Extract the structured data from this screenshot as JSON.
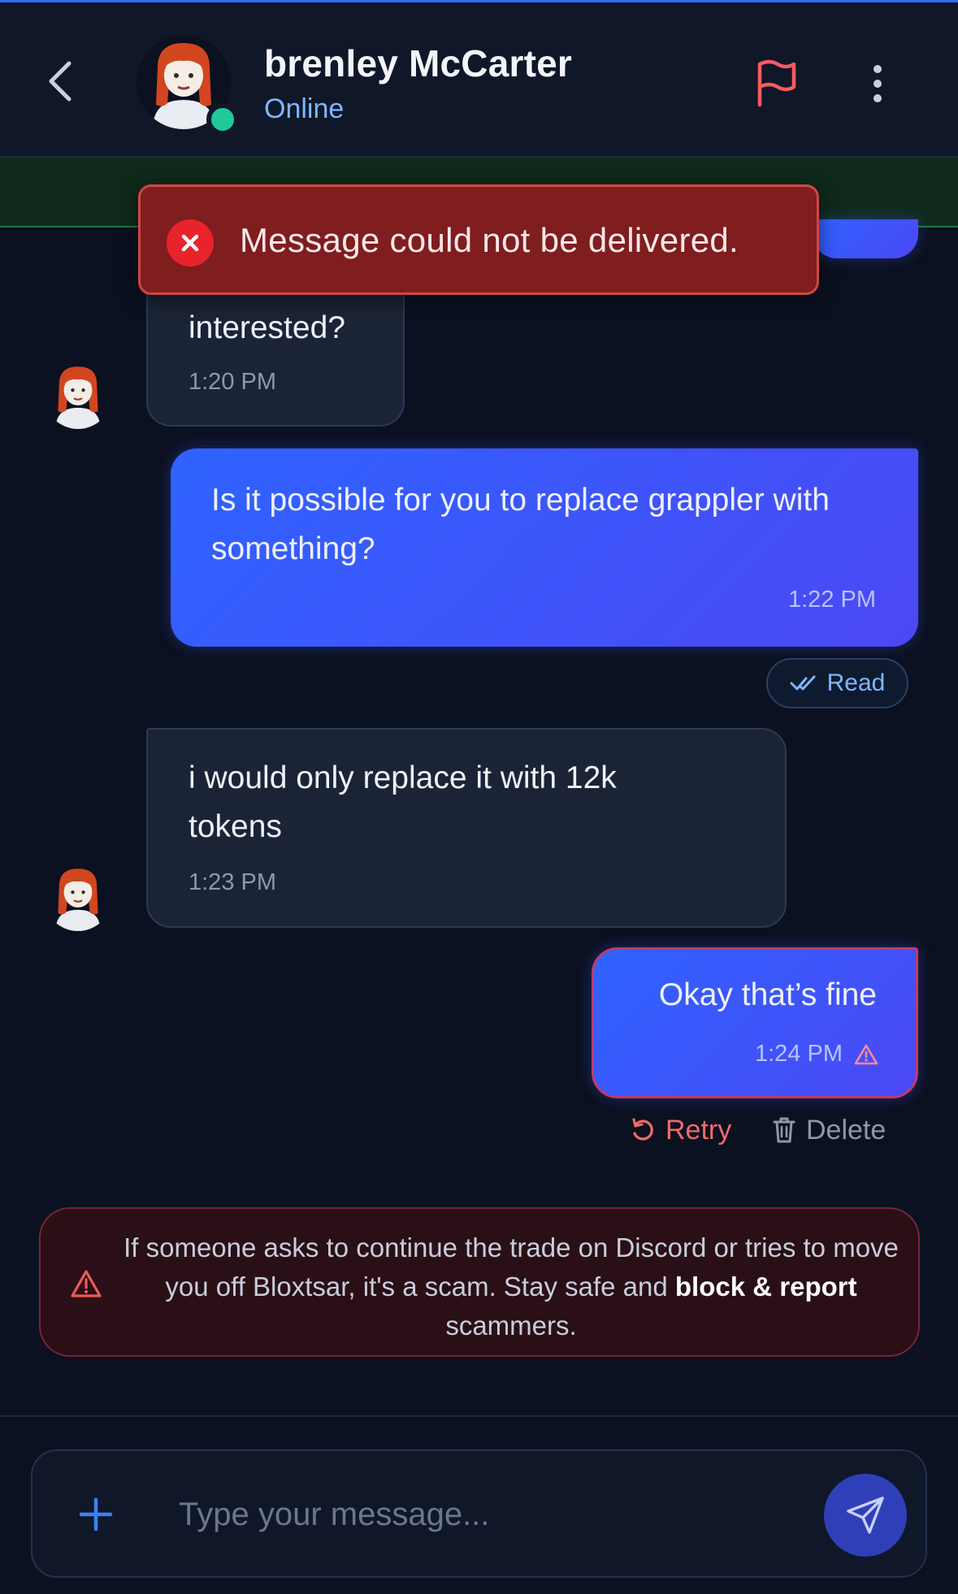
{
  "header": {
    "contact_name": "brenley McCarter",
    "status": "Online"
  },
  "toast": {
    "message": "Message could not be delivered."
  },
  "messages": [
    {
      "direction": "in",
      "text": "interested?",
      "time": "1:20 PM"
    },
    {
      "direction": "out",
      "text": "Is it possible for you to replace grappler with something?",
      "time": "1:22 PM",
      "receipt": "Read"
    },
    {
      "direction": "in",
      "text": "i would only replace it with 12k tokens",
      "time": "1:23 PM"
    },
    {
      "direction": "out",
      "text": "Okay that’s fine",
      "time": "1:24 PM",
      "failed": true
    }
  ],
  "failed_actions": {
    "retry_label": "Retry",
    "delete_label": "Delete"
  },
  "warning": {
    "text_before": "If someone asks to continue the trade on Discord or tries to move you off Bloxtsar, it's a scam. Stay safe and ",
    "bold": "block & report",
    "text_after": " scammers."
  },
  "composer": {
    "placeholder": "Type your message..."
  },
  "colors": {
    "background": "#0b1120",
    "accent": "#2f63ff",
    "online": "#20c997",
    "error": "#e8242a"
  }
}
